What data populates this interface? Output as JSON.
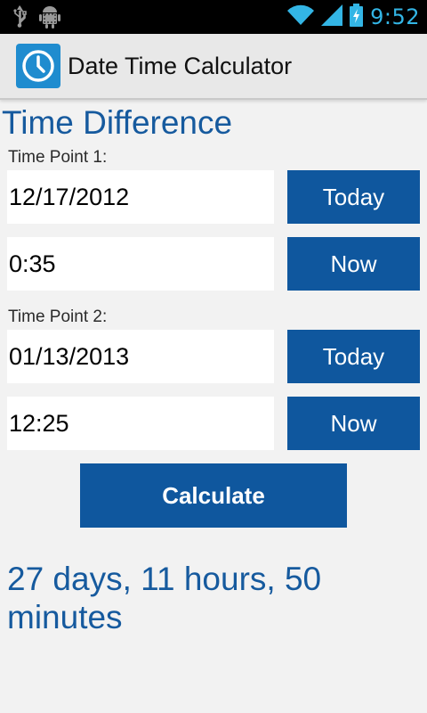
{
  "status_bar": {
    "time": "9:52",
    "icons": [
      "usb-icon",
      "android-debug-icon",
      "wifi-icon",
      "signal-icon",
      "battery-charging-icon"
    ],
    "clock_color": "#33b5e5"
  },
  "action_bar": {
    "title": "Date Time Calculator",
    "icon": "clock-icon"
  },
  "main": {
    "section_title": "Time Difference",
    "time_point_1": {
      "label": "Time Point 1:",
      "date": "12/17/2012",
      "time": "0:35",
      "today_label": "Today",
      "now_label": "Now"
    },
    "time_point_2": {
      "label": "Time Point 2:",
      "date": "01/13/2013",
      "time": "12:25",
      "today_label": "Today",
      "now_label": "Now"
    },
    "calculate_label": "Calculate",
    "result": "27 days, 11 hours, 50 minutes"
  },
  "colors": {
    "accent": "#0f579e",
    "title_text": "#165a9e",
    "background": "#f2f2f2"
  }
}
